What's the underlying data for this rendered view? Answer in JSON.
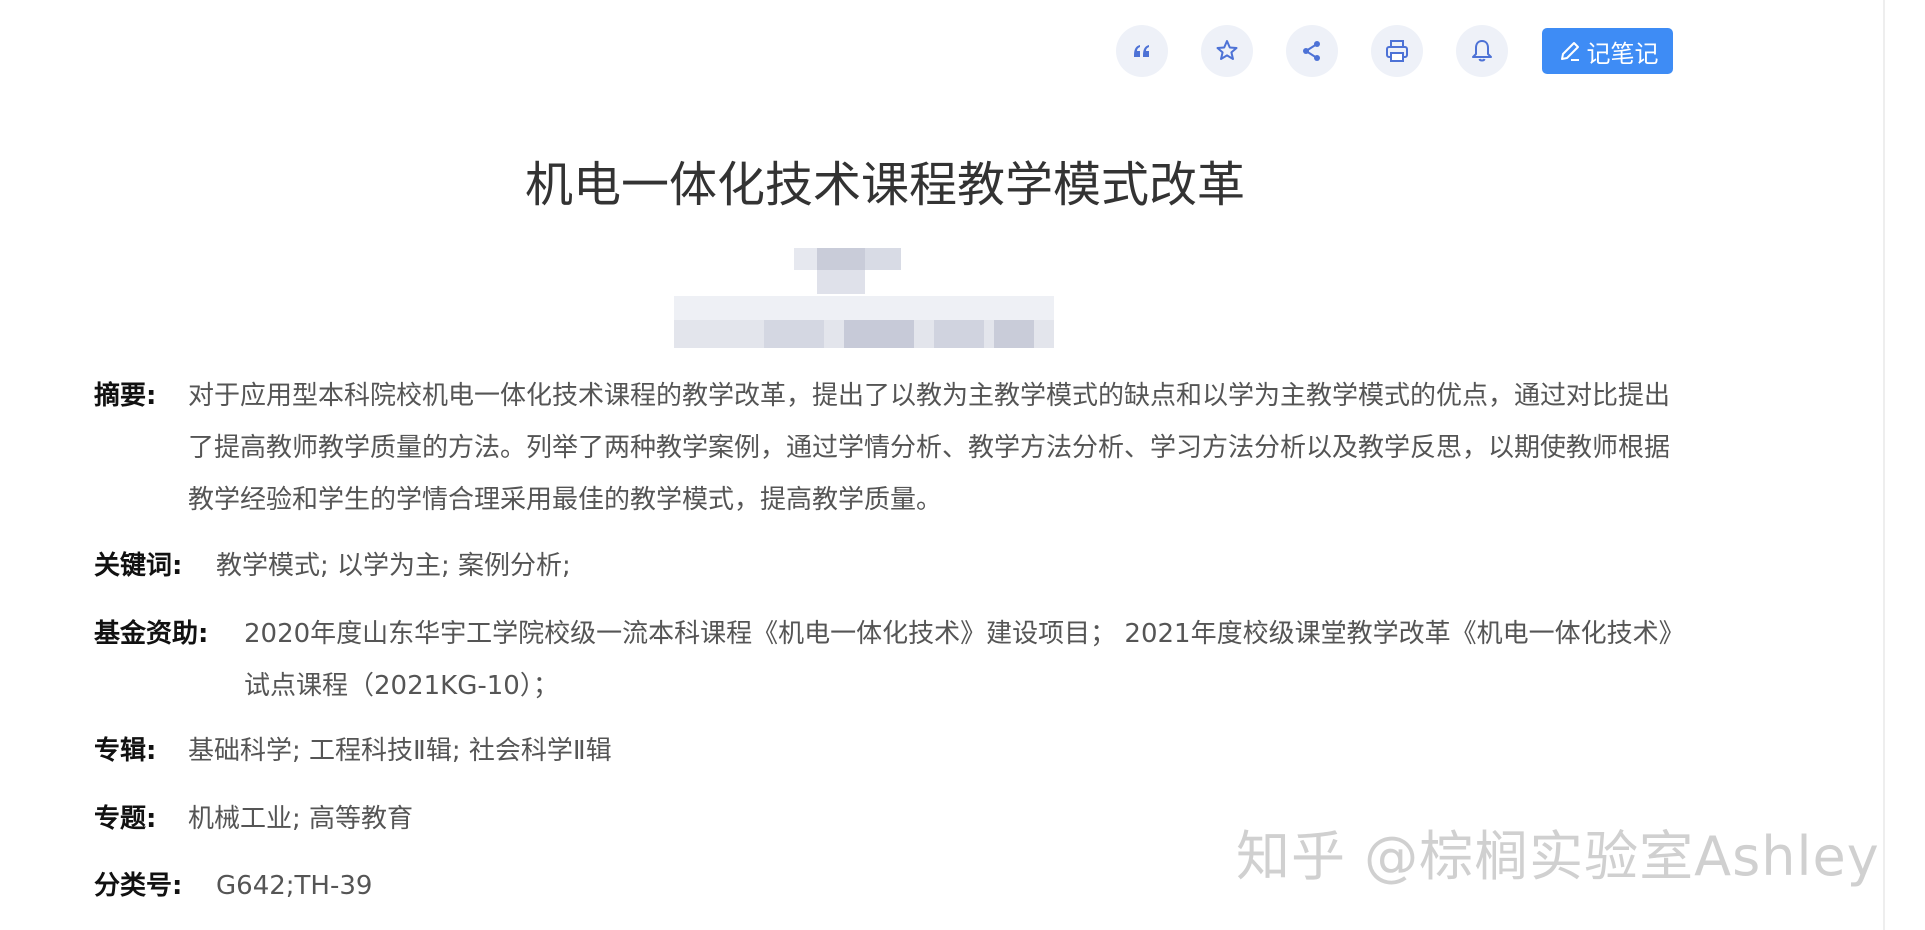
{
  "toolbar": {
    "icons": [
      "quote-icon",
      "star-icon",
      "share-icon",
      "print-icon",
      "bell-icon"
    ],
    "note_label": "记笔记",
    "accent": "#3e8cf5",
    "icon_color": "#4d72d6"
  },
  "article": {
    "title": "机电一体化技术课程教学模式改革",
    "abstract_label": "摘要:",
    "abstract": "对于应用型本科院校机电一体化技术课程的教学改革，提出了以教为主教学模式的缺点和以学为主教学模式的优点，通过对比提出了提高教师教学质量的方法。列举了两种教学案例，通过学情分析、教学方法分析、学习方法分析以及教学反思，以期使教师根据教学经验和学生的学情合理采用最佳的教学模式，提高教学质量。",
    "keywords_label": "关键词:",
    "keywords": "教学模式;  以学为主;  案例分析;",
    "fund_label": "基金资助:",
    "fund": "2020年度山东华宇工学院校级一流本科课程《机电一体化技术》建设项目；  2021年度校级课堂教学改革《机电一体化技术》试点课程（2021KG-10）；",
    "album_label": "专辑:",
    "album": "基础科学; 工程科技Ⅱ辑; 社会科学Ⅱ辑",
    "topic_label": "专题:",
    "topic": "机械工业; 高等教育",
    "class_label": "分类号:",
    "class_no": "G642;TH-39"
  },
  "watermark": "知乎 @棕榈实验室Ashley"
}
